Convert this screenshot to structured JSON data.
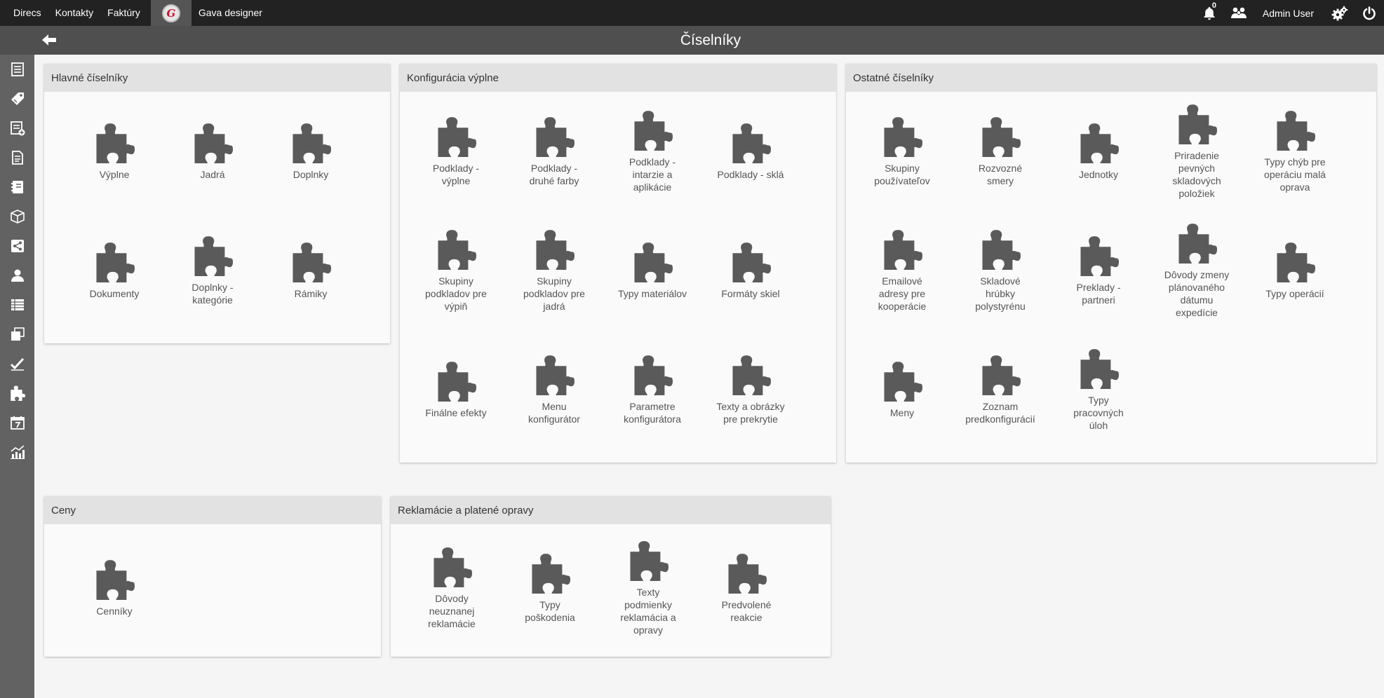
{
  "topbar": {
    "links": [
      {
        "id": "directs",
        "label": "Direcs"
      },
      {
        "id": "contacts",
        "label": "Kontakty"
      },
      {
        "id": "invoices",
        "label": "Faktúry"
      }
    ],
    "logo_letter": "G",
    "app_link": "Gava designer",
    "notifications_count": "0",
    "user_name": "Admin User"
  },
  "header": {
    "title": "Číselníky"
  },
  "sidebar": {
    "items": [
      "list-icon",
      "tag-icon",
      "list-add-icon",
      "document-icon",
      "notebook-icon",
      "box-icon",
      "share-icon",
      "user-icon",
      "table-icon",
      "stack-icon",
      "check-icon",
      "puzzle-icon",
      "calendar-icon",
      "chart-icon"
    ]
  },
  "panels": {
    "main": {
      "title": "Hlavné číselníky",
      "items": [
        "Výplne",
        "Jadrá",
        "Doplnky",
        "Dokumenty",
        "Doplnky - kategórie",
        "Rámiky"
      ]
    },
    "config": {
      "title": "Konfigurácia výplne",
      "items": [
        "Podklady - výplne",
        "Podklady - druhé farby",
        "Podklady - intarzie a aplikácie",
        "Podklady - sklá",
        "Skupiny podkladov pre výpiň",
        "Skupiny podkladov pre jadrá",
        "Typy materiálov",
        "Formáty skiel",
        "Finálne efekty",
        "Menu konfigurátor",
        "Parametre konfigurátora",
        "Texty a obrázky pre prekrytie"
      ]
    },
    "other": {
      "title": "Ostatné číselníky",
      "items": [
        "Skupiny používateľov",
        "Rozvozné smery",
        "Jednotky",
        "Priradenie pevných skladových položiek",
        "Typy chýb pre operáciu malá oprava",
        "Emailové adresy pre kooperácie",
        "Skladové hrúbky polystyrénu",
        "Preklady - partneri",
        "Dôvody zmeny plánovaného dátumu expedície",
        "Typy operácií",
        "Meny",
        "Zoznam predkonfigurácií",
        "Typy pracovných úloh"
      ]
    },
    "prices": {
      "title": "Ceny",
      "items": [
        "Cenníky"
      ]
    },
    "claims": {
      "title": "Reklamácie a platené opravy",
      "items": [
        "Dôvody neuznanej reklamácie",
        "Typy poškodenia",
        "Texty podmienky reklamácia a opravy",
        "Predvolené reakcie"
      ]
    }
  },
  "colors": {
    "icon": "#5a5a5a",
    "topbar": "#222222",
    "header": "#4f4f4f",
    "sidebar": "#626262"
  }
}
